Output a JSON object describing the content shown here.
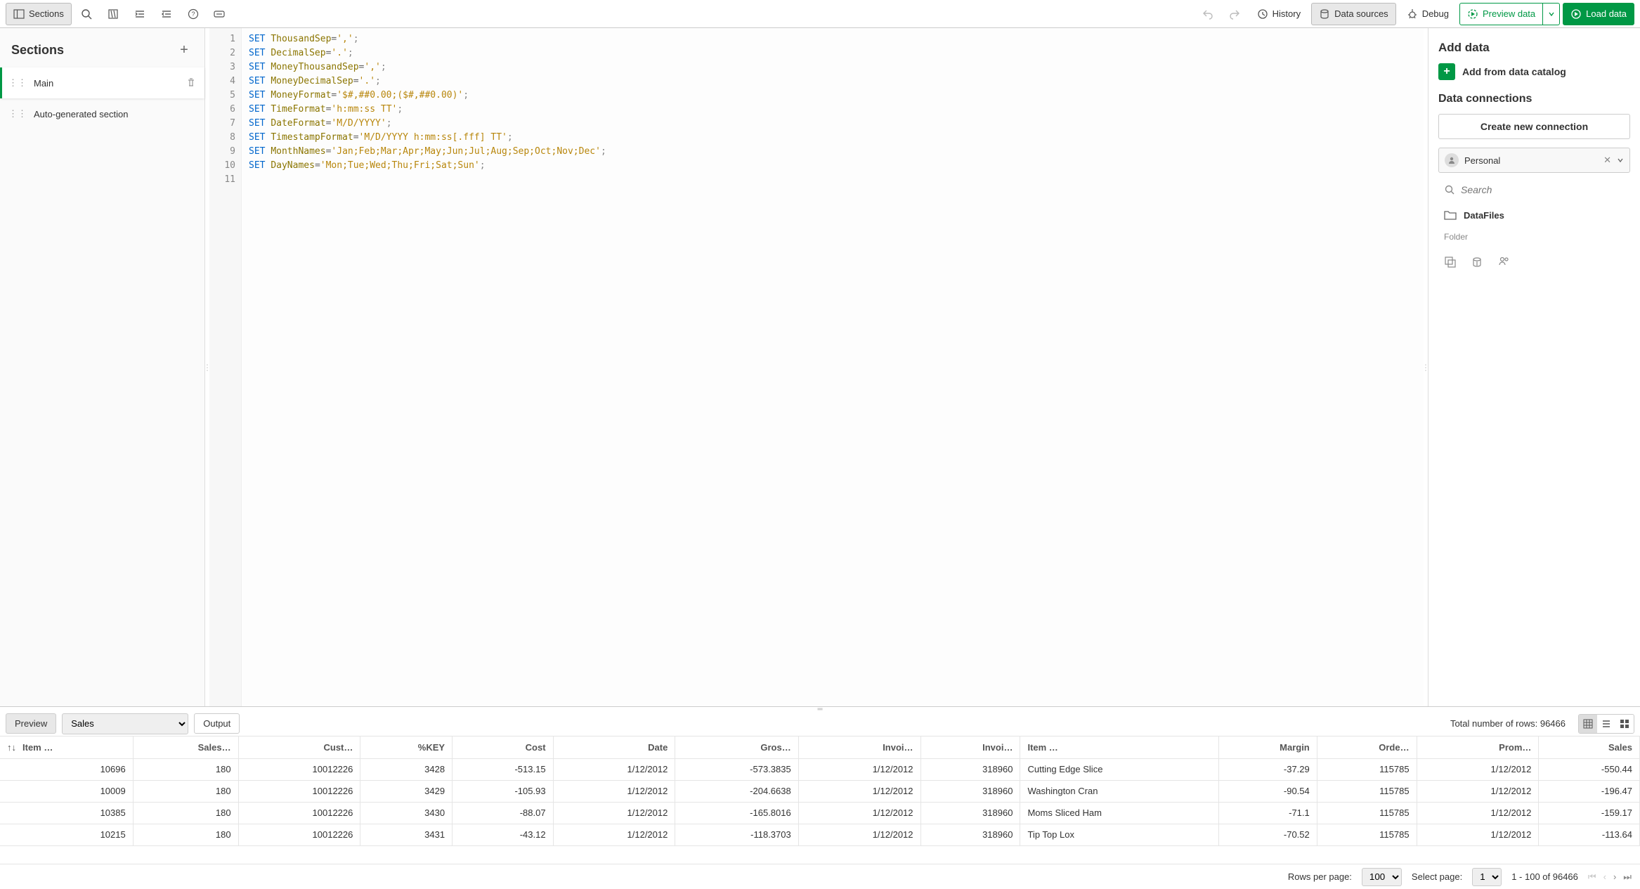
{
  "toolbar": {
    "sections_btn": "Sections",
    "history": "History",
    "data_sources": "Data sources",
    "debug": "Debug",
    "preview_data": "Preview data",
    "load_data": "Load data"
  },
  "sidebar_left": {
    "title": "Sections",
    "items": [
      {
        "label": "Main",
        "active": true
      },
      {
        "label": "Auto-generated section",
        "active": false
      }
    ]
  },
  "editor": {
    "lines": [
      {
        "n": 1,
        "kw": "SET",
        "var": "ThousandSep",
        "op": "=",
        "str": "','",
        "end": ";"
      },
      {
        "n": 2,
        "kw": "SET",
        "var": "DecimalSep",
        "op": "=",
        "str": "'.'",
        "end": ";"
      },
      {
        "n": 3,
        "kw": "SET",
        "var": "MoneyThousandSep",
        "op": "=",
        "str": "','",
        "end": ";"
      },
      {
        "n": 4,
        "kw": "SET",
        "var": "MoneyDecimalSep",
        "op": "=",
        "str": "'.'",
        "end": ";"
      },
      {
        "n": 5,
        "kw": "SET",
        "var": "MoneyFormat",
        "op": "=",
        "str": "'$#,##0.00;($#,##0.00)'",
        "end": ";"
      },
      {
        "n": 6,
        "kw": "SET",
        "var": "TimeFormat",
        "op": "=",
        "str": "'h:mm:ss TT'",
        "end": ";"
      },
      {
        "n": 7,
        "kw": "SET",
        "var": "DateFormat",
        "op": "=",
        "str": "'M/D/YYYY'",
        "end": ";"
      },
      {
        "n": 8,
        "kw": "SET",
        "var": "TimestampFormat",
        "op": "=",
        "str": "'M/D/YYYY h:mm:ss[.fff] TT'",
        "end": ";"
      },
      {
        "n": 9,
        "kw": "SET",
        "var": "MonthNames",
        "op": "=",
        "str": "'Jan;Feb;Mar;Apr;May;Jun;Jul;Aug;Sep;Oct;Nov;Dec'",
        "end": ";"
      },
      {
        "n": 10,
        "kw": "SET",
        "var": "DayNames",
        "op": "=",
        "str": "'Mon;Tue;Wed;Thu;Fri;Sat;Sun'",
        "end": ";"
      },
      {
        "n": 11,
        "kw": "",
        "var": "",
        "op": "",
        "str": "",
        "end": ""
      }
    ]
  },
  "sidebar_right": {
    "add_data_title": "Add data",
    "add_from_catalog": "Add from data catalog",
    "data_connections_title": "Data connections",
    "create_new_connection": "Create new connection",
    "personal_chip": "Personal",
    "search_placeholder": "Search",
    "datafiles": "DataFiles",
    "folder_label": "Folder"
  },
  "bottom": {
    "preview_tab": "Preview",
    "output_tab": "Output",
    "table_select": "Sales",
    "total_rows_label": "Total number of rows: 96466",
    "columns": [
      "Item …",
      "Sales…",
      "Cust…",
      "%KEY",
      "Cost",
      "Date",
      "Gros…",
      "Invoi…",
      "Invoi…",
      "Item …",
      "Margin",
      "Orde…",
      "Prom…",
      "Sales"
    ],
    "rows": [
      [
        "10696",
        "180",
        "10012226",
        "3428",
        "-513.15",
        "1/12/2012",
        "-573.3835",
        "1/12/2012",
        "318960",
        "Cutting Edge Slice",
        "-37.29",
        "115785",
        "1/12/2012",
        "-550.44"
      ],
      [
        "10009",
        "180",
        "10012226",
        "3429",
        "-105.93",
        "1/12/2012",
        "-204.6638",
        "1/12/2012",
        "318960",
        "Washington Cran",
        "-90.54",
        "115785",
        "1/12/2012",
        "-196.47"
      ],
      [
        "10385",
        "180",
        "10012226",
        "3430",
        "-88.07",
        "1/12/2012",
        "-165.8016",
        "1/12/2012",
        "318960",
        "Moms Sliced Ham",
        "-71.1",
        "115785",
        "1/12/2012",
        "-159.17"
      ],
      [
        "10215",
        "180",
        "10012226",
        "3431",
        "-43.12",
        "1/12/2012",
        "-118.3703",
        "1/12/2012",
        "318960",
        "Tip Top Lox",
        "-70.52",
        "115785",
        "1/12/2012",
        "-113.64"
      ]
    ],
    "rows_per_page_label": "Rows per page:",
    "rows_per_page_value": "100",
    "select_page_label": "Select page:",
    "select_page_value": "1",
    "range_label": "1 - 100 of 96466"
  }
}
